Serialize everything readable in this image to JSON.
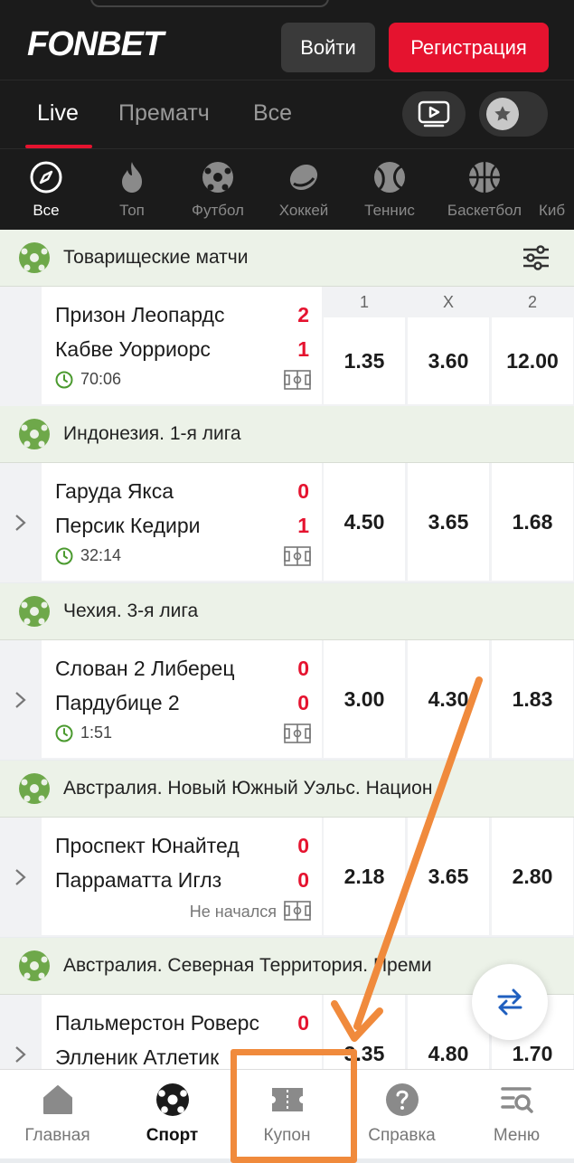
{
  "header": {
    "logo": "FONBET",
    "login_label": "Войти",
    "register_label": "Регистрация"
  },
  "tabs": [
    {
      "label": "Live",
      "active": true
    },
    {
      "label": "Прематч"
    },
    {
      "label": "Все"
    }
  ],
  "header_icons": [
    "play-icon",
    "star-icon"
  ],
  "sports": [
    {
      "label": "Все",
      "icon": "compass-icon",
      "active": true
    },
    {
      "label": "Топ",
      "icon": "flame-icon"
    },
    {
      "label": "Футбол",
      "icon": "soccer-ball-icon"
    },
    {
      "label": "Хоккей",
      "icon": "puck-icon"
    },
    {
      "label": "Теннис",
      "icon": "tennis-ball-icon"
    },
    {
      "label": "Баскетбол",
      "icon": "basketball-icon"
    },
    {
      "label": "Киб",
      "icon": "cyber-icon"
    }
  ],
  "odds_header": {
    "c1": "1",
    "cx": "X",
    "c2": "2"
  },
  "leagues": [
    {
      "name": "Товарищеские матчи",
      "match": {
        "team1": "Призон Леопардс",
        "score1": "2",
        "team2": "Кабве Уорриорс",
        "score2": "1",
        "time": "70:06",
        "odds": [
          "1.35",
          "3.60",
          "12.00"
        ]
      }
    },
    {
      "name": "Индонезия. 1-я лига",
      "match": {
        "team1": "Гаруда Якса",
        "score1": "0",
        "team2": "Персик Кедири",
        "score2": "1",
        "time": "32:14",
        "odds": [
          "4.50",
          "3.65",
          "1.68"
        ]
      }
    },
    {
      "name": "Чехия. 3-я лига",
      "match": {
        "team1": "Слован 2 Либерец",
        "score1": "0",
        "team2": "Пардубице 2",
        "score2": "0",
        "time": "1:51",
        "odds": [
          "3.00",
          "4.30",
          "1.83"
        ]
      }
    },
    {
      "name": "Австралия. Новый Южный Уэльс. Национ",
      "match": {
        "team1": "Проспект Юнайтед",
        "score1": "0",
        "team2": "Парраматта Иглз",
        "score2": "0",
        "status": "Не начался",
        "odds": [
          "2.18",
          "3.65",
          "2.80"
        ]
      }
    },
    {
      "name": "Австралия. Северная Территория. Преми",
      "match": {
        "team1": "Пальмерстон Роверс",
        "score1": "0",
        "team2": "Элленик Атлетик",
        "score2": "",
        "odds": [
          "3.35",
          "4.80",
          "1.70"
        ]
      }
    }
  ],
  "bottom_nav": [
    {
      "label": "Главная",
      "icon": "home-icon"
    },
    {
      "label": "Спорт",
      "icon": "soccer-ball-icon",
      "active": true
    },
    {
      "label": "Купон",
      "icon": "coupon-icon"
    },
    {
      "label": "Справка",
      "icon": "help-icon"
    },
    {
      "label": "Меню",
      "icon": "menu-search-icon"
    }
  ],
  "colors": {
    "brand_red": "#e5132f",
    "header_bg": "#1b1b1b",
    "league_bg": "#ecf2e8",
    "annotation": "#f08a3c"
  }
}
